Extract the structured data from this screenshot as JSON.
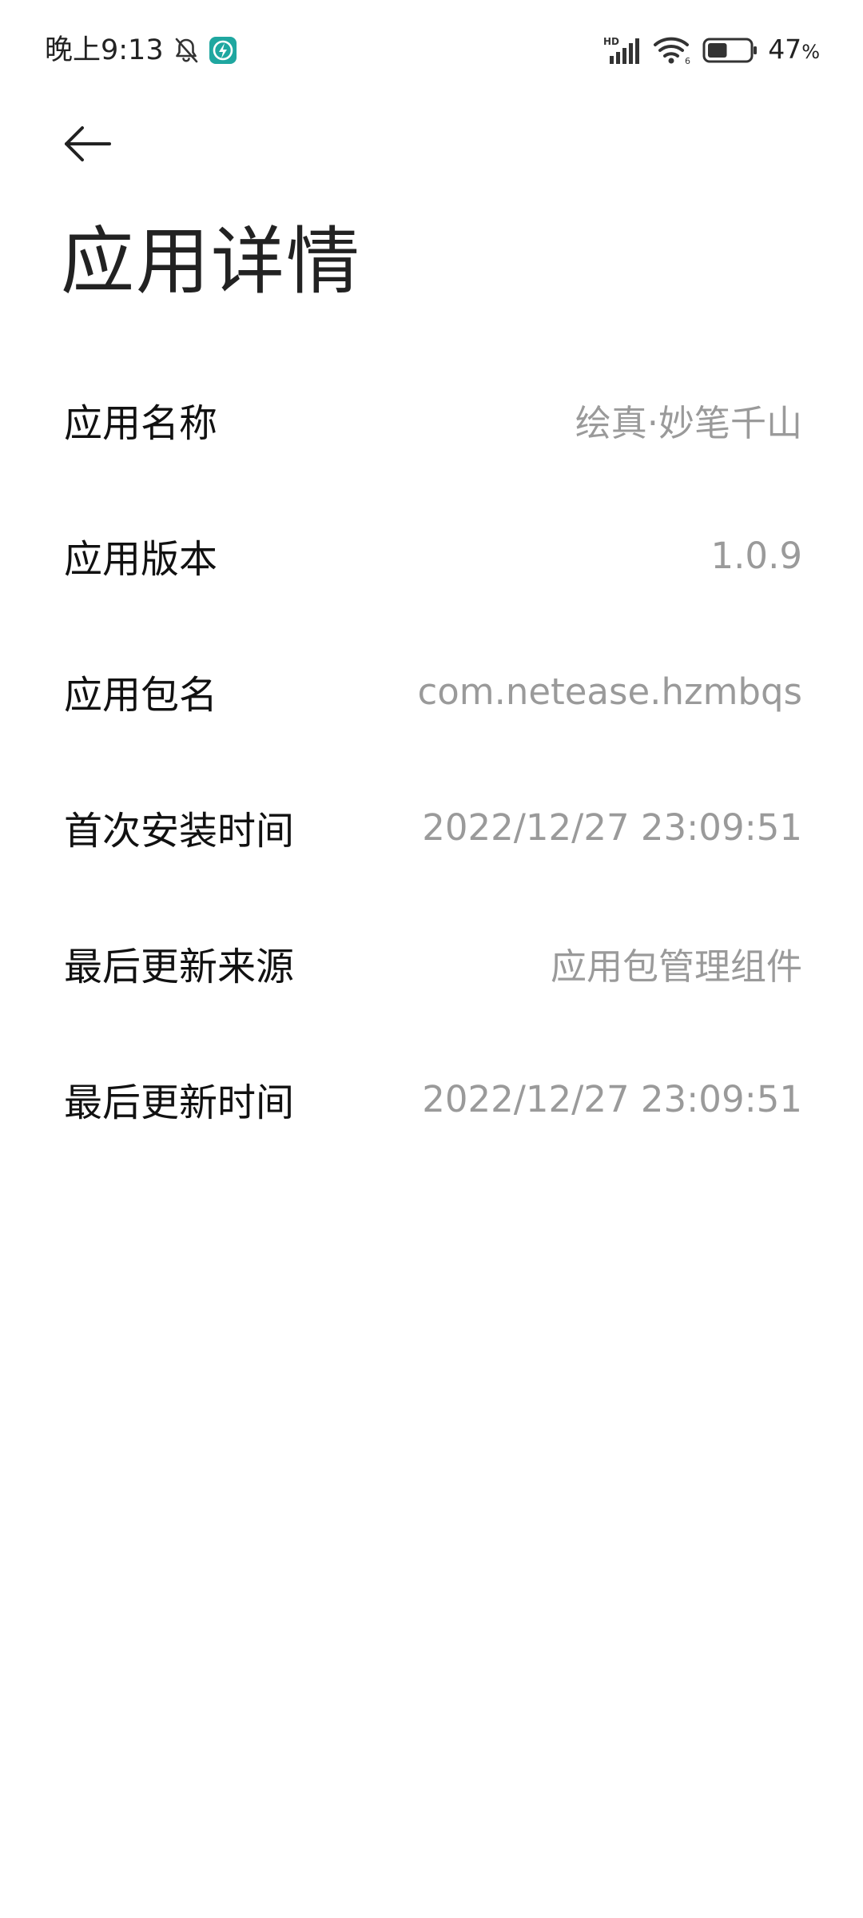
{
  "status_bar": {
    "time": "晚上9:13",
    "battery_percent": "47",
    "battery_unit": "%",
    "battery_level": 0.47,
    "network_label": "HD"
  },
  "icons": {
    "bell": "bell-muted-icon",
    "app_notification": "app-notification-icon",
    "signal": "signal-icon",
    "wifi": "wifi-icon",
    "battery": "battery-icon",
    "back": "back-arrow-icon"
  },
  "colors": {
    "label": "#111111",
    "value": "#9a9a9a",
    "app_icon_bg": "#1fa7a0"
  },
  "page": {
    "title": "应用详情"
  },
  "rows": [
    {
      "label": "应用名称",
      "value": "绘真·妙笔千山"
    },
    {
      "label": "应用版本",
      "value": "1.0.9"
    },
    {
      "label": "应用包名",
      "value": "com.netease.hzmbqs"
    },
    {
      "label": "首次安装时间",
      "value": "2022/12/27 23:09:51"
    },
    {
      "label": "最后更新来源",
      "value": "应用包管理组件"
    },
    {
      "label": "最后更新时间",
      "value": "2022/12/27 23:09:51"
    }
  ]
}
